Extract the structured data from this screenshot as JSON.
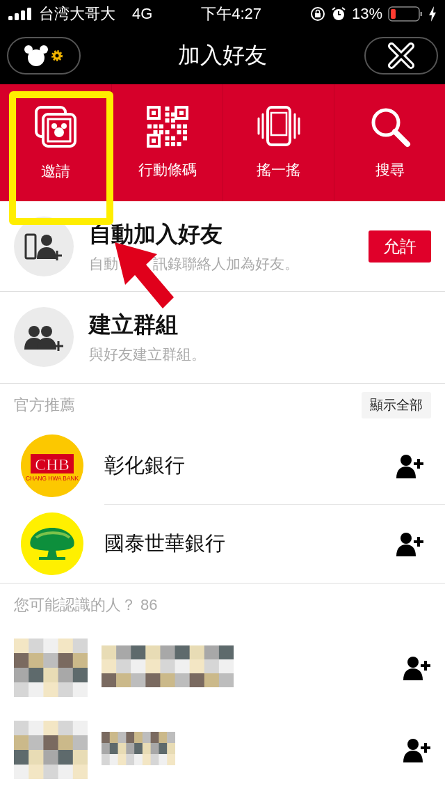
{
  "status_bar": {
    "carrier": "台湾大哥大",
    "network": "4G",
    "time": "下午4:27",
    "battery": "13%"
  },
  "header": {
    "title": "加入好友"
  },
  "tabs": [
    {
      "label": "邀請",
      "kind": "invite",
      "highlighted": true
    },
    {
      "label": "行動條碼",
      "kind": "qr",
      "highlighted": false
    },
    {
      "label": "搖一搖",
      "kind": "shake",
      "highlighted": false
    },
    {
      "label": "搜尋",
      "kind": "search",
      "highlighted": false
    }
  ],
  "actions": [
    {
      "kind": "contacts",
      "title": "自動加入好友",
      "subtitle_parts": [
        "自動",
        "訊錄聯絡人加為好友。"
      ],
      "button": "允許"
    },
    {
      "kind": "group",
      "title": "建立群組",
      "subtitle_parts": [
        "與好友建立群組。"
      ]
    }
  ],
  "official": {
    "heading": "官方推薦",
    "show_all": "顯示全部",
    "accounts": [
      {
        "kind": "chb",
        "name": "彰化銀行",
        "logo_text": "CHB",
        "logo_subtext": "CHANG HWA BANK"
      },
      {
        "kind": "tree",
        "name": "國泰世華銀行"
      }
    ]
  },
  "suggestions": {
    "heading": "您可能認識的人？ 86"
  }
}
